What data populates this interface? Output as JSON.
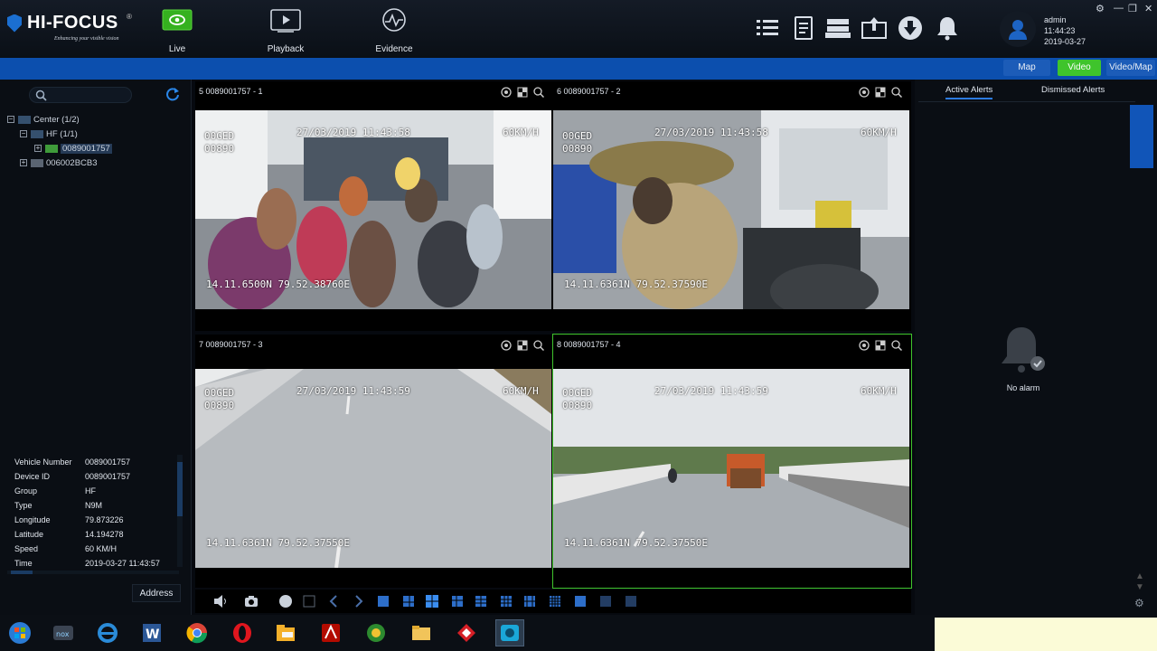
{
  "brand": {
    "name": "HI-FOCUS",
    "reg": "®",
    "tagline": "Enhancing your visible vision"
  },
  "nav": [
    {
      "label": "Live"
    },
    {
      "label": "Playback"
    },
    {
      "label": "Evidence"
    }
  ],
  "user": {
    "name": "admin",
    "time": "11:44:23",
    "date": "2019-03-27"
  },
  "view_tabs": {
    "map": "Map",
    "video": "Video",
    "video_map": "Video/Map"
  },
  "search": {
    "placeholder": ""
  },
  "tree": {
    "root": "Center (1/2)",
    "group": "HF (1/1)",
    "device1": "0089001757",
    "device2": "006002BCB3"
  },
  "info": {
    "vehicle_number_label": "Vehicle Number",
    "vehicle_number": "0089001757",
    "device_id_label": "Device ID",
    "device_id": "0089001757",
    "group_label": "Group",
    "group": "HF",
    "type_label": "Type",
    "type": "N9M",
    "longitude_label": "Longitude",
    "longitude": "79.873226",
    "latitude_label": "Latitude",
    "latitude": "14.194278",
    "speed_label": "Speed",
    "speed": "60 KM/H",
    "time_label": "Time",
    "time": "2019-03-27 11:43:57"
  },
  "address_button": "Address",
  "panes": [
    {
      "title": "5 0089001757 - 1",
      "osd_l1": "00GED",
      "osd_l2": "00890",
      "osd_ts": "27/03/2019  11:43:58",
      "osd_speed": "60KM/H",
      "osd_gps": "14.11.6500N 79.52.38760E"
    },
    {
      "title": "6 0089001757 - 2",
      "osd_l1": "00GED",
      "osd_l2": "00890",
      "osd_ts": "27/03/2019  11:43:58",
      "osd_speed": "60KM/H",
      "osd_gps": "14.11.6361N 79.52.37590E"
    },
    {
      "title": "7 0089001757 - 3",
      "osd_l1": "00GED",
      "osd_l2": "00890",
      "osd_ts": "27/03/2019  11:43:59",
      "osd_speed": "60KM/H",
      "osd_gps": "14.11.6361N 79.52.37550E"
    },
    {
      "title": "8 0089001757 - 4",
      "osd_l1": "00GED",
      "osd_l2": "00890",
      "osd_ts": "27/03/2019  11:43:59",
      "osd_speed": "60KM/H",
      "osd_gps": "14.11.6361N 79.52.37550E"
    }
  ],
  "alerts": {
    "active_tab": "Active Alerts",
    "dismissed_tab": "Dismissed Alerts",
    "empty": "No alarm"
  },
  "colors": {
    "accent": "#0c4fae",
    "active": "#3fc42c",
    "panel": "#0a0e14"
  },
  "taskbar": {
    "icons": [
      "start-icon",
      "nox-icon",
      "ie-icon",
      "word-icon",
      "chrome-icon",
      "opera-icon",
      "folder-app-icon",
      "acrobat-icon",
      "network-icon",
      "explorer-icon",
      "anydesk-icon",
      "camera-app-icon"
    ]
  }
}
